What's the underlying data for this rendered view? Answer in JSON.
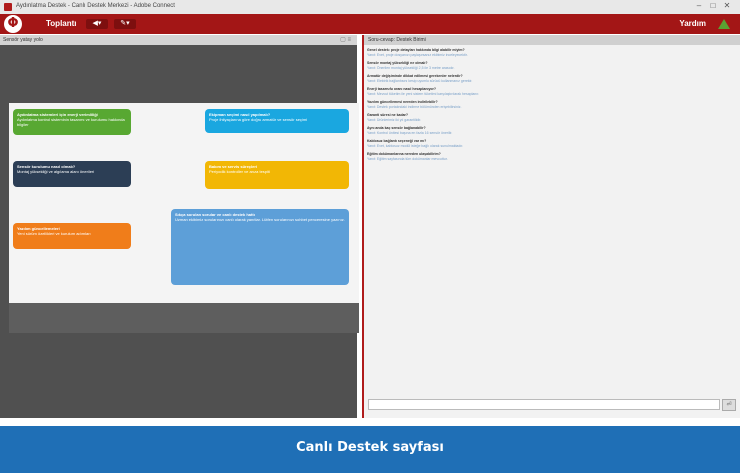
{
  "window": {
    "title": "Aydınlatma Destek - Canlı Destek Merkezi - Adobe Connect"
  },
  "menubar": {
    "meeting": "Toplantı",
    "help": "Yardım"
  },
  "left_pod": {
    "title": "Sensör yatay yolo"
  },
  "chat": {
    "title": "Soru-cevap: Destek Birimi",
    "send": "⏎"
  },
  "cards": [
    {
      "title": "Aydınlatma sistemleri için enerji verimliliği",
      "body": "Aydınlatma kontrol sisteminin tasarımı ve kurulumu hakkında bilgiler",
      "color": "#58a832"
    },
    {
      "title": "Ekipman seçimi nasıl yapılmalı?",
      "body": "Proje ihtiyaçlarına göre doğru armatür ve sensör seçimi",
      "color": "#1aa7e0"
    },
    {
      "title": "Sensör kurulumu nasıl olmalı?",
      "body": "Montaj yüksekliği ve algılama alanı önerileri",
      "color": "#2c3e55"
    },
    {
      "title": "Bakım ve servis süreçleri",
      "body": "Periyodik kontroller ve arıza tespiti",
      "color": "#f2b705"
    },
    {
      "title": "Yazılım güncellemeleri",
      "body": "Yeni sürüm özellikleri ve kurulum adımları",
      "color": "#f07d1a"
    },
    {
      "title": "Sıkça sorulan sorular ve canlı destek hattı",
      "body": "Uzman ekibimiz sorularınızı canlı olarak yanıtlar. Lütfen sorularınızı sohbet penceresine yazınız.",
      "color": "#5d9fd8"
    }
  ],
  "messages": [
    {
      "q": "Genel destek: proje detayları hakkında bilgi alabilir miyim?",
      "a": "Yanıt: Evet, proje dosyanızı paylaşırsanız ekibimiz inceleyecektir."
    },
    {
      "q": "Sensör montaj yüksekliği ne olmalı?",
      "a": "Yanıt: Önerilen montaj yüksekliği 2,5 ile 3 metre arasıdır."
    },
    {
      "q": "Armatür değişiminde dikkat edilmesi gerekenler nelerdir?",
      "a": "Yanıt: Elektrik bağlantısını kesip uyumlu sürücü kullanmanız gerekir."
    },
    {
      "q": "Enerji tasarrufu oranı nasıl hesaplanıyor?",
      "a": "Yanıt: Mevcut tüketim ile yeni sistem tüketimi karşılaştırılarak hesaplanır."
    },
    {
      "q": "Yazılım güncellemesi nereden indirilebilir?",
      "a": "Yanıt: Destek portalındaki indirme bölümünden erişebilirsiniz."
    },
    {
      "q": "Garanti süresi ne kadar?",
      "a": "Yanıt: Ürünlerimiz iki yıl garantilidir."
    },
    {
      "q": "Aynı anda kaç sensör bağlanabilir?",
      "a": "Yanıt: Kontrol ünitesi başına en fazla 16 sensör önerilir."
    },
    {
      "q": "Kablosuz bağlantı seçeneği var mı?",
      "a": "Yanıt: Evet, kablosuz modül isteğe bağlı olarak sunulmaktadır."
    },
    {
      "q": "Eğitim dokümanlarına nereden ulaşabilirim?",
      "a": "Yanıt: Eğitim sayfasında tüm dokümanlar mevcuttur."
    }
  ],
  "banner": {
    "caption": "Canlı Destek sayfası"
  }
}
